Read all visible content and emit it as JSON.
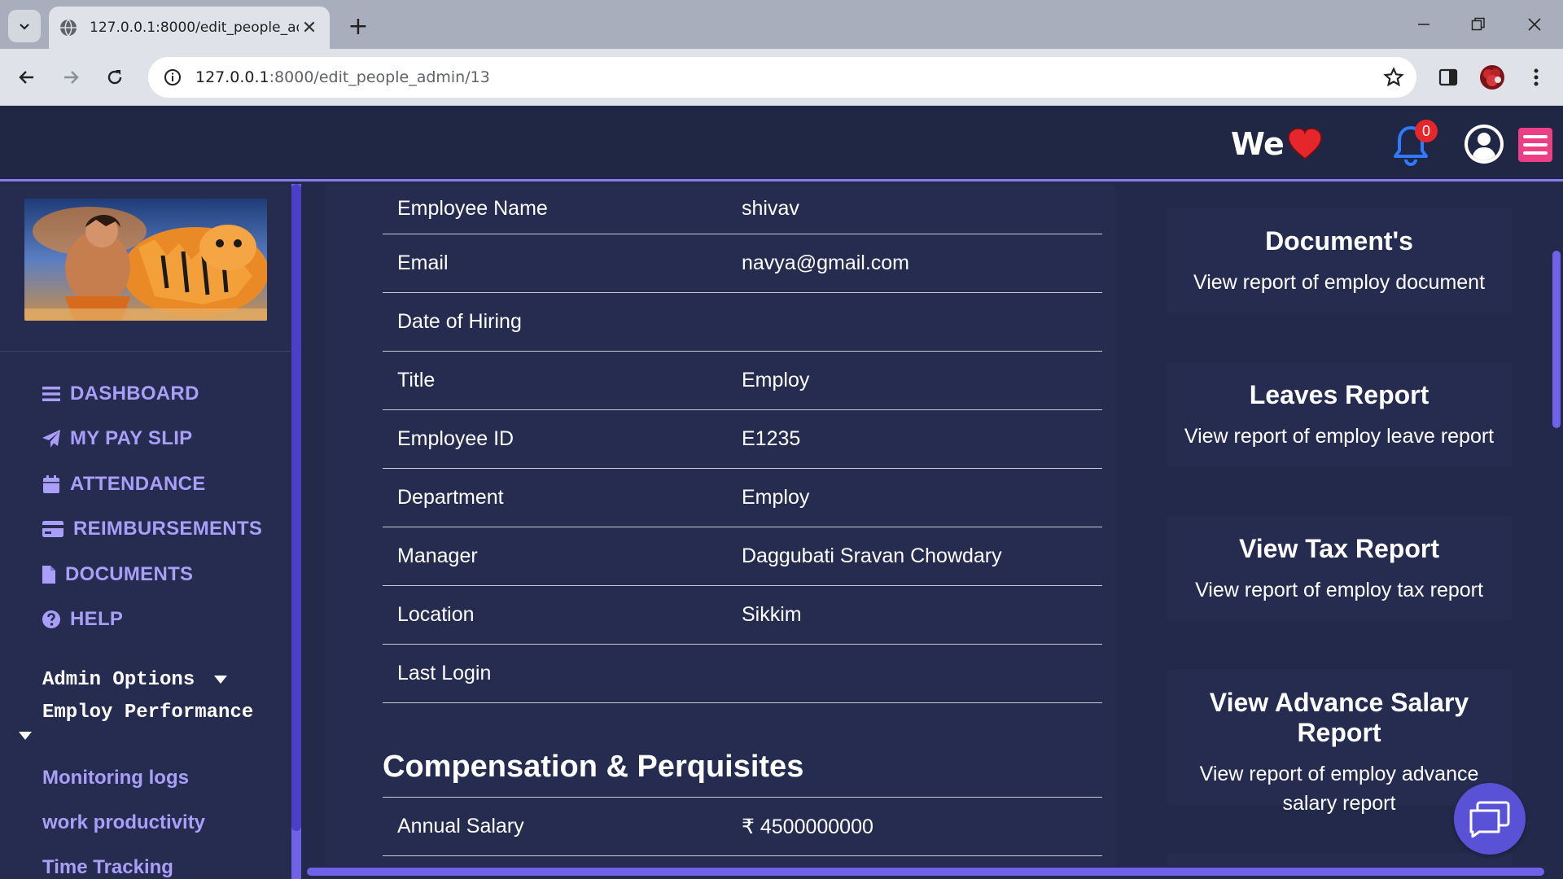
{
  "browser": {
    "tab_title": "127.0.0.1:8000/edit_people_adm",
    "url_host": "127.0.0.1",
    "url_rest": ":8000/edit_people_admin/13"
  },
  "header": {
    "logo_text": "We",
    "notification_count": "0"
  },
  "sidebar": {
    "menu": [
      {
        "label": "DASHBOARD",
        "icon": "bars-icon"
      },
      {
        "label": "MY PAY SLIP",
        "icon": "paper-plane-icon"
      },
      {
        "label": "ATTENDANCE",
        "icon": "calendar-icon"
      },
      {
        "label": "REIMBURSEMENTS",
        "icon": "credit-card-icon"
      },
      {
        "label": "DOCUMENTS",
        "icon": "file-icon"
      },
      {
        "label": "HELP",
        "icon": "question-circle-icon"
      }
    ],
    "admin_options_label": "Admin Options",
    "employ_performance_label": "Employ Performance",
    "sub_links": [
      "Monitoring logs",
      "work productivity",
      "Time Tracking"
    ]
  },
  "details": {
    "rows": [
      {
        "label": "Employee Name",
        "value": "shivav"
      },
      {
        "label": "Email",
        "value": "navya@gmail.com"
      },
      {
        "label": "Date of Hiring",
        "value": ""
      },
      {
        "label": "Title",
        "value": "Employ"
      },
      {
        "label": "Employee ID",
        "value": "E1235"
      },
      {
        "label": "Department",
        "value": "Employ"
      },
      {
        "label": "Manager",
        "value": "Daggubati Sravan Chowdary"
      },
      {
        "label": "Location",
        "value": "Sikkim"
      },
      {
        "label": "Last Login",
        "value": ""
      }
    ],
    "compensation_heading": "Compensation & Perquisites",
    "annual_salary_label": "Annual Salary",
    "annual_salary_value": "₹ 4500000000"
  },
  "reports": [
    {
      "title": "Document's",
      "desc": "View report of employ document"
    },
    {
      "title": "Leaves Report",
      "desc": "View report of employ leave report"
    },
    {
      "title": "View Tax Report",
      "desc": "View report of employ tax report"
    },
    {
      "title": "View Advance Salary Report",
      "desc": "View report of employ advance salary report"
    }
  ],
  "colors": {
    "accent": "#a99ef8",
    "header_bg": "#202745",
    "sidebar_bg": "#262c50",
    "hamburger": "#ec3f86",
    "heart": "#e5262b"
  }
}
